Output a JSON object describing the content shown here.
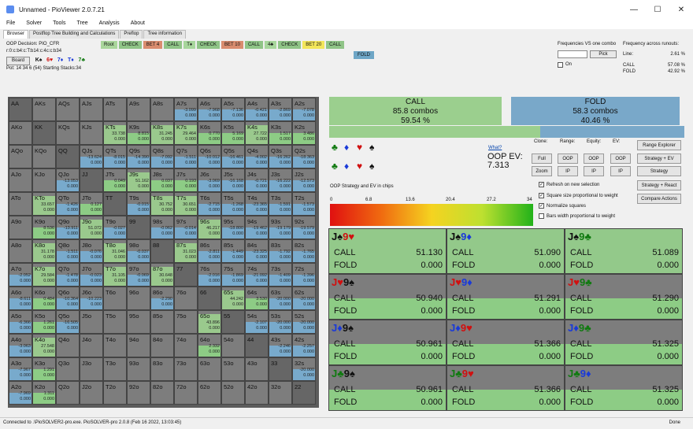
{
  "window": {
    "title": "Unnamed - PioViewer 2.0.7.21",
    "minimize": "—",
    "maximize": "☐",
    "close": "✕"
  },
  "menu": [
    "File",
    "Solver",
    "Tools",
    "Tree",
    "Analysis",
    "About"
  ],
  "tabs": [
    "Browser",
    "Postflop Tree Building and Calculations",
    "Preflop",
    "Tree information"
  ],
  "info": {
    "decision": "OOP Decision:  PIO_CFR",
    "line": "r:0:c:b4:c:T:b14:c:4c:c:b34",
    "board_btn": "Board",
    "board_cards": [
      "K♠",
      "6♥",
      "7♦",
      "T♦",
      "7♣"
    ],
    "pot": "Pot: 14 34 6 (54) Starting Stacks:34"
  },
  "actions": [
    "Root",
    "CHECK",
    "BET 4",
    "CALL",
    "T♦",
    "CHECK",
    "BET 10",
    "CALL",
    "4♣",
    "CHECK",
    "BET 20",
    "CALL"
  ],
  "fold_action": "FOLD",
  "freq_panel": {
    "title": "Frequencies VS one combo",
    "pick": "Pick",
    "on": "On",
    "runouts_title": "Frequency across runouts:",
    "line_label": "Line:",
    "line_value": "2.61 %",
    "call_label": "CALL",
    "call_value": "57.08 %",
    "fold_label": "FOLD",
    "fold_value": "42.92 %"
  },
  "grid": [
    [
      [
        "AA",
        "",
        ""
      ],
      [
        "AKs",
        "",
        ""
      ],
      [
        "AQs",
        "",
        ""
      ],
      [
        "AJs",
        "",
        ""
      ],
      [
        "ATs",
        "",
        ""
      ],
      [
        "A9s",
        "",
        ""
      ],
      [
        "A8s",
        "",
        ""
      ],
      [
        "A7s",
        "-3.099",
        "0.000"
      ],
      [
        "A6s",
        "-7.968",
        "0.000"
      ],
      [
        "A5s",
        "-7.136",
        "0.000"
      ],
      [
        "A4s",
        "-0.421",
        "0.000"
      ],
      [
        "A3s",
        "-2.869",
        "0.000"
      ],
      [
        "A2s",
        "-7.078",
        "0.000"
      ]
    ],
    [
      [
        "AKo",
        "",
        ""
      ],
      [
        "KK",
        "",
        ""
      ],
      [
        "KQs",
        "",
        ""
      ],
      [
        "KJs",
        "",
        ""
      ],
      [
        "KTs",
        "33.738",
        "0.000"
      ],
      [
        "K9s",
        "8.815",
        "0.000"
      ],
      [
        "K8s",
        "31.245",
        "0.000"
      ],
      [
        "K7s",
        "29.464",
        "0.000"
      ],
      [
        "K6s",
        "0.770",
        "0.000"
      ],
      [
        "K5s",
        "5.169",
        "0.000"
      ],
      [
        "K4s",
        "27.722",
        "0.000"
      ],
      [
        "K3s",
        "1.517",
        "0.000"
      ],
      [
        "K2s",
        "3.486",
        "0.000"
      ]
    ],
    [
      [
        "AQo",
        "",
        ""
      ],
      [
        "KQo",
        "",
        ""
      ],
      [
        "QQ",
        "",
        ""
      ],
      [
        "QJs",
        "-13.624",
        "0.000"
      ],
      [
        "QTs",
        "-8.015",
        "0.000"
      ],
      [
        "Q9s",
        "-14.390",
        "0.000"
      ],
      [
        "Q8s",
        "-7.092",
        "0.000"
      ],
      [
        "Q7s",
        "-1.511",
        "0.000"
      ],
      [
        "Q6s",
        "-10.012",
        "0.000"
      ],
      [
        "Q5s",
        "-16.461",
        "0.000"
      ],
      [
        "Q4s",
        "-4.002",
        "0.000"
      ],
      [
        "Q3s",
        "-16.262",
        "0.000"
      ],
      [
        "Q2s",
        "-18.363",
        "0.000"
      ]
    ],
    [
      [
        "AJo",
        "",
        ""
      ],
      [
        "KJo",
        "",
        ""
      ],
      [
        "QJo",
        "-13.053",
        "0.000"
      ],
      [
        "JJ",
        "",
        ""
      ],
      [
        "JTs",
        "0.049",
        "0.000"
      ],
      [
        "J9s",
        "51.162",
        "0.000"
      ],
      [
        "J8s",
        "0.037",
        "0.000"
      ],
      [
        "J7s",
        "0.193",
        "0.000"
      ],
      [
        "J6s",
        "-3.069",
        "0.000"
      ],
      [
        "J5s",
        "-16.168",
        "0.000"
      ],
      [
        "J4s",
        "-0.721",
        "0.000"
      ],
      [
        "J3s",
        "-16.222",
        "0.000"
      ],
      [
        "J2s",
        "-12.573",
        "0.000"
      ]
    ],
    [
      [
        "ATo",
        "",
        ""
      ],
      [
        "KTo",
        "33.657",
        "0.000"
      ],
      [
        "QTo",
        "-1.426",
        "0.000"
      ],
      [
        "JTo",
        "0.127",
        "0.000"
      ],
      [
        "TT",
        "",
        ""
      ],
      [
        "T9s",
        "-0.015",
        "0.000"
      ],
      [
        "T8s",
        "30.752",
        "0.000"
      ],
      [
        "T7s",
        "30.651",
        "0.000"
      ],
      [
        "T6s",
        "-2.715",
        "0.000"
      ],
      [
        "T5s",
        "-1.268",
        "0.000"
      ],
      [
        "T4s",
        "-23.365",
        "0.000"
      ],
      [
        "T3s",
        "-1.591",
        "0.000"
      ],
      [
        "T2s",
        "-1.573",
        "0.000"
      ]
    ],
    [
      [
        "A9o",
        "",
        ""
      ],
      [
        "K9o",
        "8.536",
        "0.000"
      ],
      [
        "Q9o",
        "-13.911",
        "0.000"
      ],
      [
        "J9o",
        "51.072",
        "0.000"
      ],
      [
        "T9o",
        "-0.027",
        "0.000"
      ],
      [
        "99",
        "",
        ""
      ],
      [
        "98s",
        "-0.062",
        "0.000"
      ],
      [
        "97s",
        "-0.014",
        "0.000"
      ],
      [
        "96s",
        "46.217",
        "0.000"
      ],
      [
        "95s",
        "-18.800",
        "0.000"
      ],
      [
        "94s",
        "-19.462",
        "0.000"
      ],
      [
        "93s",
        "-19.179",
        "0.000"
      ],
      [
        "92s",
        "-19.579",
        "0.000"
      ]
    ],
    [
      [
        "A8o",
        "",
        ""
      ],
      [
        "K8o",
        "31.178",
        "0.000"
      ],
      [
        "Q8o",
        "-1.511",
        "0.000"
      ],
      [
        "J8o",
        "-0.076",
        "0.000"
      ],
      [
        "T8o",
        "31.046",
        "0.000"
      ],
      [
        "98o",
        "-0.037",
        "0.000"
      ],
      [
        "88",
        "",
        ""
      ],
      [
        "87s",
        "31.023",
        "0.000"
      ],
      [
        "86s",
        "-2.811",
        "0.000"
      ],
      [
        "85s",
        "-1.449",
        "0.000"
      ],
      [
        "84s",
        "-23.325",
        "0.000"
      ],
      [
        "83s",
        "-1.792",
        "0.000"
      ],
      [
        "82s",
        "-1.765",
        "0.000"
      ]
    ],
    [
      [
        "A7o",
        "-2.052",
        "0.000"
      ],
      [
        "K7o",
        "29.584",
        "0.000"
      ],
      [
        "Q7o",
        "-1.478",
        "0.000"
      ],
      [
        "J7o",
        "-0.023",
        "0.000"
      ],
      [
        "T7o",
        "31.105",
        "0.000"
      ],
      [
        "97o",
        "-0.069",
        "0.000"
      ],
      [
        "87o",
        "30.648",
        "0.000"
      ],
      [
        "77",
        "",
        ""
      ],
      [
        "76s",
        "-2.016",
        "0.000"
      ],
      [
        "75s",
        "-1.869",
        "0.000"
      ],
      [
        "74s",
        "-21.092",
        "0.000"
      ],
      [
        "73s",
        "-1.409",
        "0.000"
      ],
      [
        "72s",
        "-1.396",
        "0.000"
      ]
    ],
    [
      [
        "A6o",
        "-8.611",
        "0.000"
      ],
      [
        "K6o",
        "0.484",
        "0.000"
      ],
      [
        "Q6o",
        "-10.364",
        "0.000"
      ],
      [
        "J6o",
        "-10.223",
        "0.000"
      ],
      [
        "T6o",
        "",
        ""
      ],
      [
        "96o",
        "",
        ""
      ],
      [
        "86o",
        "-2.290",
        "0.000"
      ],
      [
        "76o",
        "",
        ""
      ],
      [
        "66",
        "",
        ""
      ],
      [
        "65s",
        "44.242",
        "0.000"
      ],
      [
        "64s",
        "3.530",
        "0.000"
      ],
      [
        "63s",
        "-20.000",
        "0.000"
      ],
      [
        "62s",
        "-20.000",
        "0.000"
      ]
    ],
    [
      [
        "A5o",
        "-6.366",
        "0.000"
      ],
      [
        "K5o",
        "1.261",
        "0.000"
      ],
      [
        "Q5o",
        "-16.505",
        "0.000"
      ],
      [
        "J5o",
        "",
        ""
      ],
      [
        "T5o",
        "",
        ""
      ],
      [
        "95o",
        "",
        ""
      ],
      [
        "85o",
        "",
        ""
      ],
      [
        "75o",
        "",
        ""
      ],
      [
        "65o",
        "43.896",
        "0.000"
      ],
      [
        "55",
        "",
        ""
      ],
      [
        "54s",
        "-2.107",
        "0.000"
      ],
      [
        "53s",
        "-20.000",
        "0.000"
      ],
      [
        "52s",
        "-20.000",
        "0.000"
      ]
    ],
    [
      [
        "A4o",
        "-3.063",
        "0.000"
      ],
      [
        "K4o",
        "27.548",
        "0.000"
      ],
      [
        "Q4o",
        "",
        ""
      ],
      [
        "J4o",
        "",
        ""
      ],
      [
        "T4o",
        "",
        ""
      ],
      [
        "94o",
        "",
        ""
      ],
      [
        "84o",
        "",
        ""
      ],
      [
        "74o",
        "",
        ""
      ],
      [
        "64o",
        "2.332",
        "0.000"
      ],
      [
        "54o",
        "",
        ""
      ],
      [
        "44",
        "",
        ""
      ],
      [
        "43s",
        "-2.246",
        "0.000"
      ],
      [
        "42s",
        "-2.257",
        "0.000"
      ]
    ],
    [
      [
        "A3o",
        "-7.967",
        "0.000"
      ],
      [
        "K3o",
        "1.291",
        "0.000"
      ],
      [
        "Q3o",
        "",
        ""
      ],
      [
        "J3o",
        "",
        ""
      ],
      [
        "T3o",
        "",
        ""
      ],
      [
        "93o",
        "",
        ""
      ],
      [
        "83o",
        "",
        ""
      ],
      [
        "73o",
        "",
        ""
      ],
      [
        "63o",
        "",
        ""
      ],
      [
        "53o",
        "",
        ""
      ],
      [
        "43o",
        "",
        ""
      ],
      [
        "33",
        "",
        ""
      ],
      [
        "32s",
        "-20.000",
        "0.000"
      ]
    ],
    [
      [
        "A2o",
        "-7.969",
        "0.000"
      ],
      [
        "K2o",
        "1.311",
        "0.000"
      ],
      [
        "Q2o",
        "",
        ""
      ],
      [
        "J2o",
        "",
        ""
      ],
      [
        "T2o",
        "",
        ""
      ],
      [
        "92o",
        "",
        ""
      ],
      [
        "82o",
        "",
        ""
      ],
      [
        "72o",
        "",
        ""
      ],
      [
        "62o",
        "",
        ""
      ],
      [
        "52o",
        "",
        ""
      ],
      [
        "42o",
        "",
        ""
      ],
      [
        "32o",
        "",
        ""
      ],
      [
        "22",
        "",
        ""
      ]
    ]
  ],
  "call_summary": {
    "label": "CALL",
    "combos": "85.8 combos",
    "pct": "59.54 %"
  },
  "fold_summary": {
    "label": "FOLD",
    "combos": "58.3 combos",
    "pct": "40.46 %"
  },
  "strategy_fraction": 0.595,
  "what_link": "What?",
  "oop_ev_label": "OOP EV:",
  "oop_ev_value": "7.313",
  "gradient_label": "OOP Strategy and EV in chips",
  "gradient_ticks": [
    "0",
    "6.8",
    "13.6",
    "20.4",
    "27.2",
    "34"
  ],
  "controls": {
    "labels": [
      "Clone:",
      "Range:",
      "Equity:",
      "EV:"
    ],
    "row1": [
      "Full",
      "OOP",
      "OOP",
      "OOP"
    ],
    "row2": [
      "Zoom",
      "IP",
      "IP",
      "IP"
    ],
    "side": [
      "Range Explorer",
      "Strategy + EV",
      "Strategy",
      "Strategy + React",
      "Compare Actions"
    ],
    "checks": [
      "Refresh on new selection",
      "Square size proportional to weight",
      "Normalize squares",
      "Bars width proportional to weight"
    ],
    "checked": [
      true,
      true,
      true,
      false
    ]
  },
  "hands": [
    {
      "c1": "J♠",
      "c2": "9♥",
      "call": "51.130",
      "fold": "0.000"
    },
    {
      "c1": "J♠",
      "c2": "9♦",
      "call": "51.090",
      "fold": "0.000"
    },
    {
      "c1": "J♠",
      "c2": "9♣",
      "call": "51.089",
      "fold": "0.000"
    },
    {
      "c1": "J♥",
      "c2": "9♠",
      "call": "50.940",
      "fold": "0.000"
    },
    {
      "c1": "J♥",
      "c2": "9♦",
      "call": "51.291",
      "fold": "0.000"
    },
    {
      "c1": "J♥",
      "c2": "9♣",
      "call": "51.290",
      "fold": "0.000"
    },
    {
      "c1": "J♦",
      "c2": "9♠",
      "call": "50.961",
      "fold": "0.000"
    },
    {
      "c1": "J♦",
      "c2": "9♥",
      "call": "51.366",
      "fold": "0.000"
    },
    {
      "c1": "J♦",
      "c2": "9♣",
      "call": "51.325",
      "fold": "0.000"
    },
    {
      "c1": "J♣",
      "c2": "9♠",
      "call": "50.961",
      "fold": "0.000"
    },
    {
      "c1": "J♣",
      "c2": "9♥",
      "call": "51.366",
      "fold": "0.000"
    },
    {
      "c1": "J♣",
      "c2": "9♦",
      "call": "51.325",
      "fold": "0.000"
    }
  ],
  "hand_call_label": "CALL",
  "hand_fold_label": "FOLD",
  "status": {
    "text": "Connected to .\\PioSOLVER2-pro.exe. PioSOLVER-pro 2.0.8 (Feb 16 2022, 13:03:45)",
    "done": "Done"
  },
  "colors": {
    "call": "#8dcc85",
    "fold": "#78aacc",
    "bet": "#d98c6f",
    "spade": "#111111",
    "heart": "#d01010",
    "diamond": "#1a3ad8",
    "club": "#117a11"
  }
}
